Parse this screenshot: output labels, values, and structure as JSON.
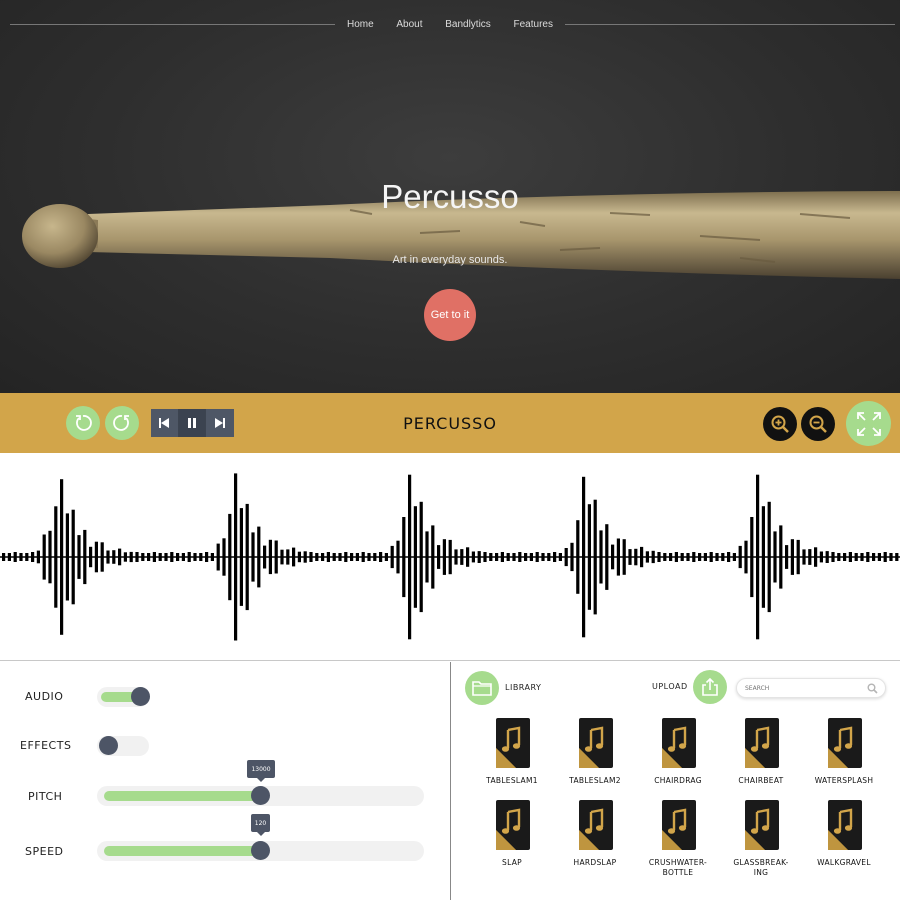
{
  "nav": {
    "items": [
      "Home",
      "About",
      "Bandlytics",
      "Features"
    ]
  },
  "hero": {
    "title": "Percusso",
    "subtitle": "Art in everyday sounds.",
    "cta_label": "Get to it"
  },
  "toolbar": {
    "title": "PERCUSSO",
    "buttons": [
      "undo-icon",
      "redo-icon",
      "skip-back-icon",
      "pause-icon",
      "skip-forward-icon",
      "zoom-in-icon",
      "zoom-out-icon",
      "fullscreen-icon"
    ]
  },
  "controls": {
    "audio_label": "AUDIO",
    "effects_label": "EFFECTS",
    "pitch_label": "PITCH",
    "speed_label": "SPEED",
    "audio_on": true,
    "effects_on": false,
    "pitch_value": "13000",
    "speed_value": "120",
    "pitch_fraction": 0.5,
    "speed_fraction": 0.5
  },
  "library": {
    "library_label": "LIBRARY",
    "upload_label": "UPLOAD",
    "search_placeholder": "SEARCH",
    "files": [
      {
        "name": "TABLESLAM1"
      },
      {
        "name": "TABLESLAM2"
      },
      {
        "name": "CHAIRDRAG"
      },
      {
        "name": "CHAIRBEAT"
      },
      {
        "name": "WATERSPLASH"
      },
      {
        "name": "SLAP"
      },
      {
        "name": "HARDSLAP"
      },
      {
        "name": "CRUSHWATER-\nBOTTLE"
      },
      {
        "name": "GLASSBREAK-\nING"
      },
      {
        "name": "WALKGRAVEL"
      }
    ]
  },
  "colors": {
    "toolbar": "#d2a54a",
    "accent_green": "#a6db8d",
    "cta": "#e07065",
    "knob": "#4d5566"
  }
}
